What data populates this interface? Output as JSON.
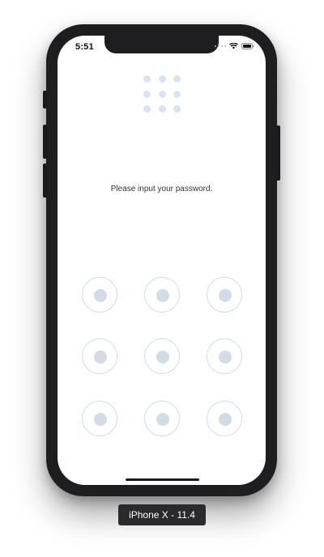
{
  "status_bar": {
    "time": "5:51",
    "icons": [
      "cellular-dots-icon",
      "wifi-icon",
      "battery-icon"
    ]
  },
  "preview_grid": {
    "rows": 3,
    "cols": 3,
    "dot_color": "#d9e4f3",
    "icon": "pattern-preview-icon"
  },
  "prompt": {
    "text": "Please input your password."
  },
  "pattern_pad": {
    "node_count": 9,
    "ring_color": "#c9dcf5",
    "core_color": "#d3dbe7"
  },
  "simulator": {
    "device_label": "iPhone X - 11.4"
  }
}
